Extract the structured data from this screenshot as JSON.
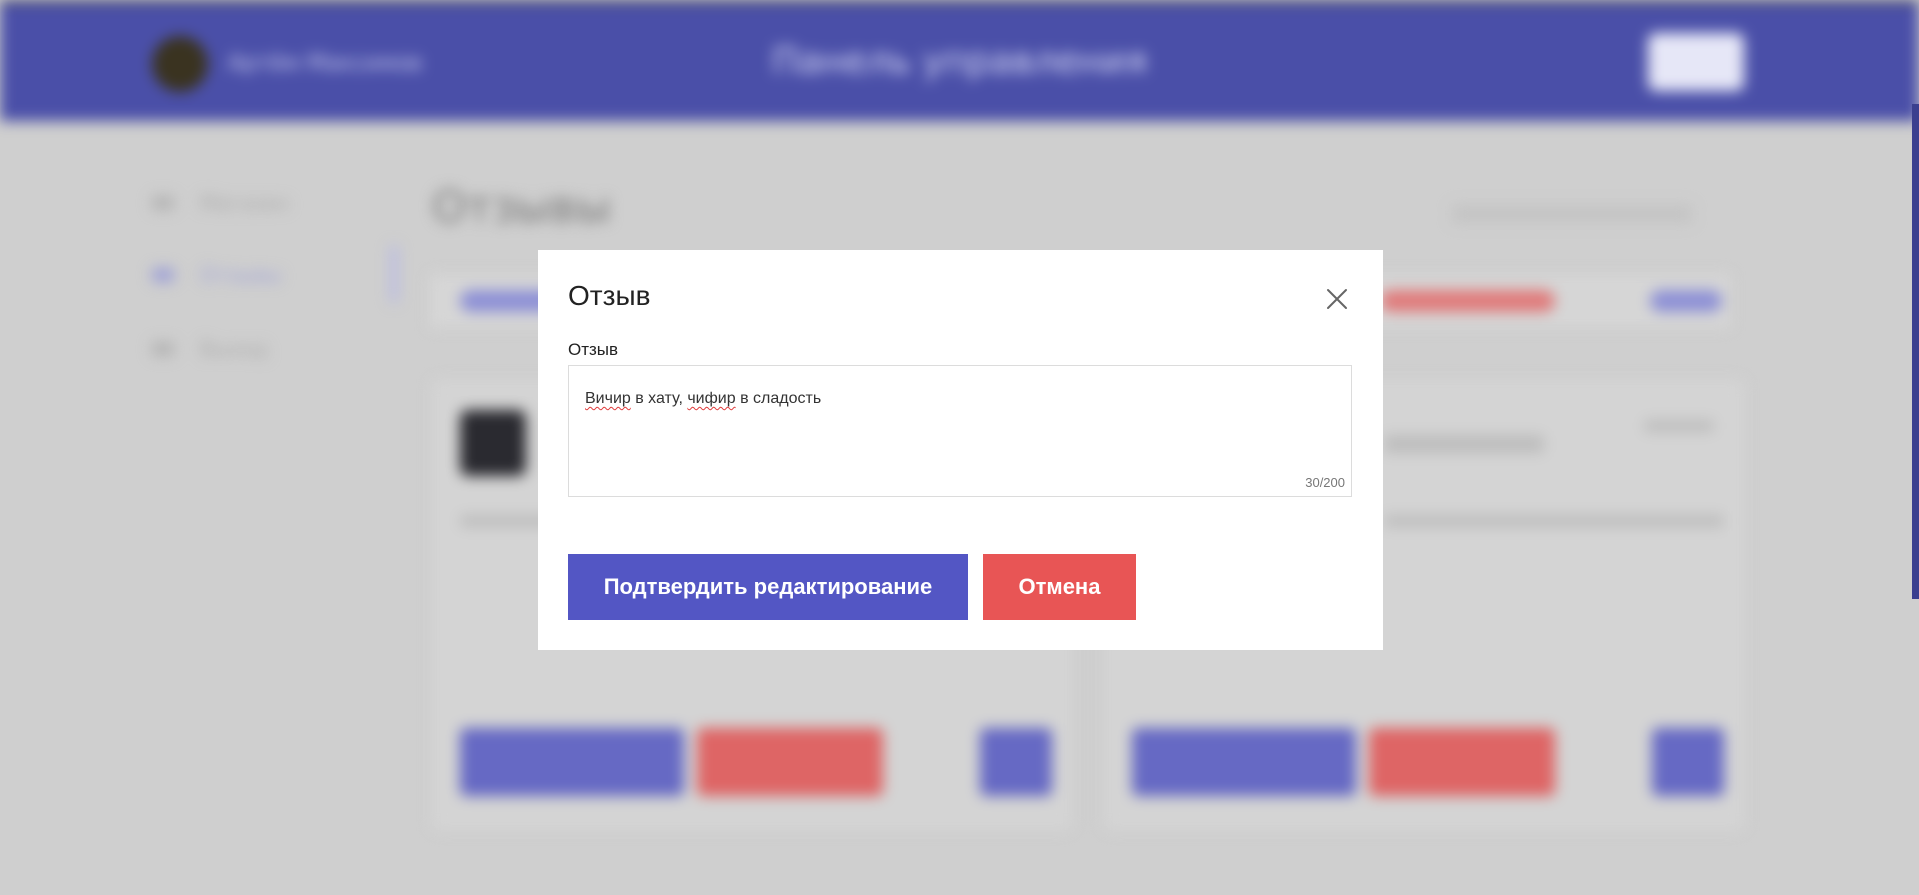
{
  "background": {
    "header_user": "Артём Максимов",
    "header_title": "Панель управления",
    "sidebar": [
      "Магазин",
      "Отзывы",
      "Выход"
    ],
    "content_title": "Отзывы"
  },
  "modal": {
    "title": "Отзыв",
    "field_label": "Отзыв",
    "review_text": {
      "parts": [
        "Вичир",
        " в хату, ",
        "чифир",
        " в сладость"
      ]
    },
    "counter": "30/200",
    "confirm_label": "Подтвердить редактирование",
    "cancel_label": "Отмена",
    "close_icon": "close-icon"
  },
  "colors": {
    "header": "#4a4fa8",
    "confirm": "#5356c4",
    "cancel": "#e85555",
    "overlay": "#cfcfcf"
  }
}
